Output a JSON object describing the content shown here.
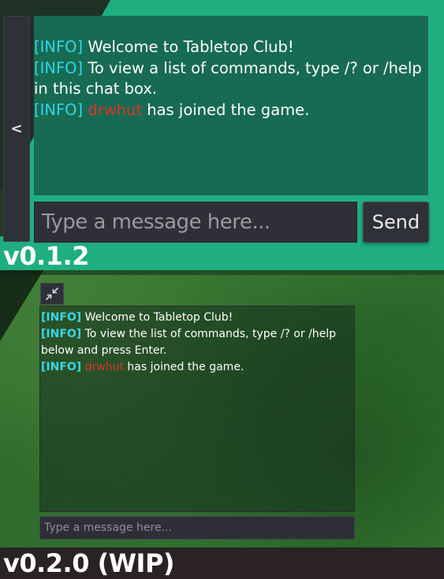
{
  "top_panel": {
    "collapse_label": "<",
    "chat_lines": [
      {
        "tag": "[INFO]",
        "text": " Welcome to Tabletop Club!"
      },
      {
        "tag": "[INFO]",
        "text": " To view a list of commands, type /? or /help in this chat box."
      },
      {
        "tag": "[INFO]",
        "player": "drwhut",
        "text": " has joined the game."
      }
    ],
    "input_placeholder": "Type a message here...",
    "send_label": "Send",
    "version": "v0.1.2"
  },
  "bottom_panel": {
    "chat_lines": [
      {
        "tag": "[INFO]",
        "text": " Welcome to Tabletop Club!"
      },
      {
        "tag": "[INFO]",
        "text": " To view the list of commands, type /? or /help below and press Enter."
      },
      {
        "tag": "[INFO]",
        "player": "drwhut",
        "text": " has joined the game."
      }
    ],
    "input_placeholder": "Type a message here...",
    "version": "v0.2.0 (WIP)"
  },
  "colors": {
    "info_tag": "#33d6e8",
    "player_name": "#e0322c",
    "top_background": "#1fae80",
    "top_chat_background": "#176b52"
  },
  "icons": {
    "expand": "collapse-arrows-icon"
  }
}
